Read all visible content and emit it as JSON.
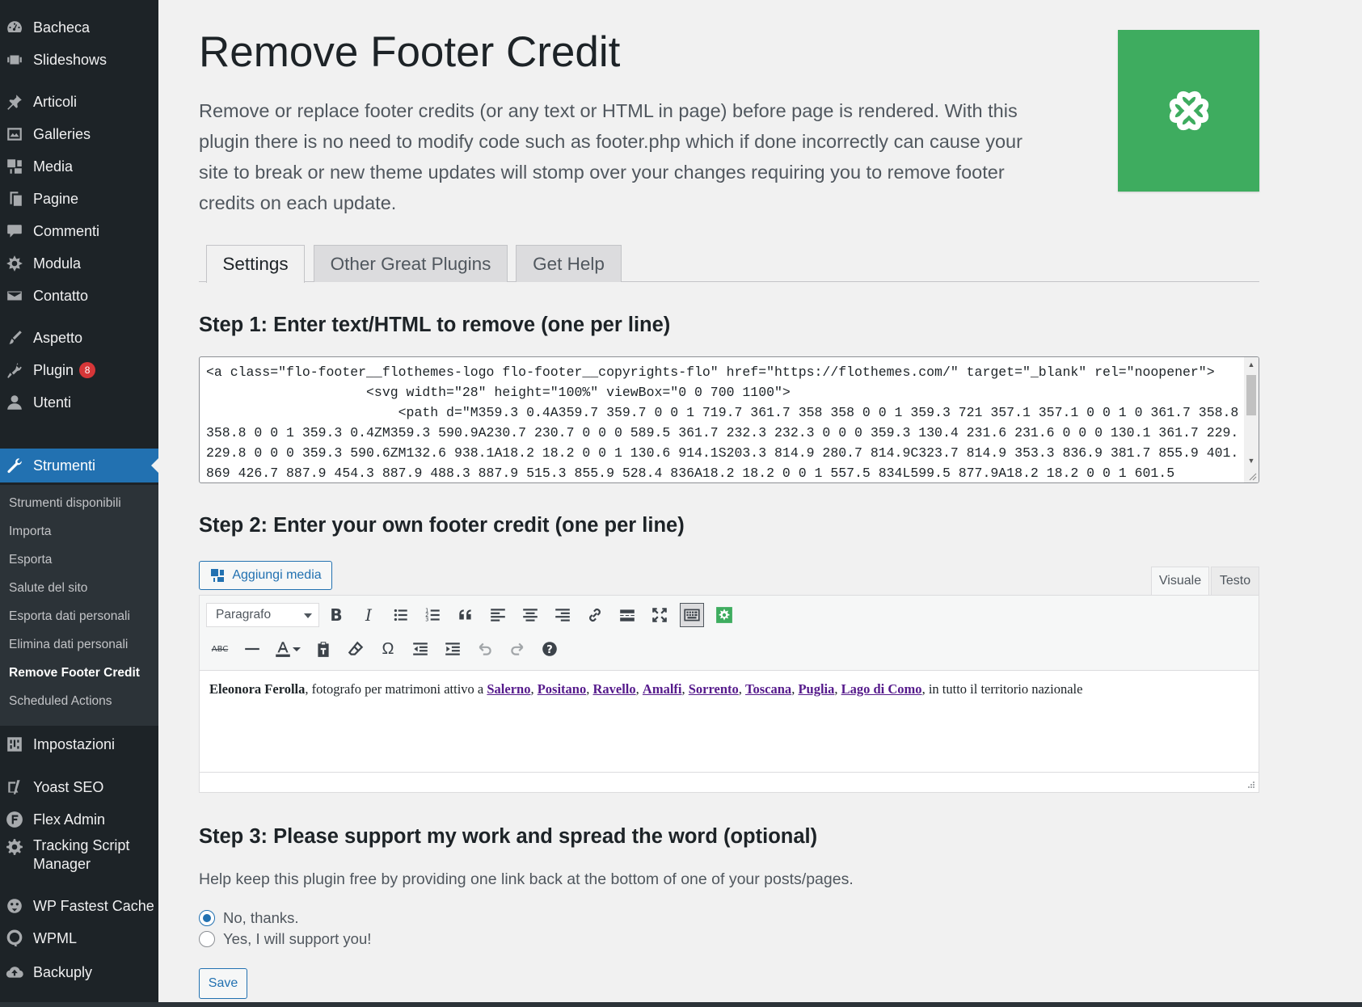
{
  "sidebar": {
    "items": [
      {
        "label": "Bacheca",
        "icon": "dashboard-icon"
      },
      {
        "label": "Slideshows",
        "icon": "slideshow-icon"
      },
      {
        "label": "Articoli",
        "icon": "pin-icon"
      },
      {
        "label": "Galleries",
        "icon": "gallery-icon"
      },
      {
        "label": "Media",
        "icon": "media-icon"
      },
      {
        "label": "Pagine",
        "icon": "page-icon"
      },
      {
        "label": "Commenti",
        "icon": "comment-icon"
      },
      {
        "label": "Modula",
        "icon": "modula-icon"
      },
      {
        "label": "Contatto",
        "icon": "mail-icon"
      },
      {
        "label": "Aspetto",
        "icon": "brush-icon"
      },
      {
        "label": "Plugin",
        "icon": "plugin-icon",
        "badge": "8"
      },
      {
        "label": "Utenti",
        "icon": "user-icon"
      },
      {
        "label": "Strumenti",
        "icon": "wrench-icon",
        "active": true
      },
      {
        "label": "Impostazioni",
        "icon": "settings-icon"
      },
      {
        "label": "Yoast SEO",
        "icon": "yoast-icon"
      },
      {
        "label": "Flex Admin",
        "icon": "flex-admin-icon"
      },
      {
        "label": "Tracking Script Manager",
        "icon": "gear-icon"
      },
      {
        "label": "WP Fastest Cache",
        "icon": "cheetah-icon"
      },
      {
        "label": "WPML",
        "icon": "wpml-icon"
      },
      {
        "label": "Backuply",
        "icon": "cloud-upload-icon"
      }
    ],
    "submenu": [
      "Strumenti disponibili",
      "Importa",
      "Esporta",
      "Salute del sito",
      "Esporta dati personali",
      "Elimina dati personali",
      "Remove Footer Credit",
      "Scheduled Actions"
    ]
  },
  "page": {
    "title": "Remove Footer Credit",
    "description": "Remove or replace footer credits (or any text or HTML in page) before page is rendered. With this plugin there is no need to modify code such as footer.php which if done incorrectly can cause your site to break or new theme updates will stomp over your changes requiring you to remove footer credits on each update.",
    "banner_color": "#3eac5f",
    "tabs": [
      "Settings",
      "Other Great Plugins",
      "Get Help"
    ],
    "active_tab": "Settings"
  },
  "step1": {
    "title": "Step 1: Enter text/HTML to remove (one per line)",
    "lines": [
      "<a class=\"flo-footer__flothemes-logo flo-footer__copyrights-flo\" href=\"https://flothemes.com/\" target=\"_blank\" rel=\"noopener\">",
      "                    <svg width=\"28\" height=\"100%\" viewBox=\"0 0 700 1100\">",
      "                        <path d=\"M359.3 0.4A359.7 359.7 0 0 1 719.7 361.7 358 358 0 0 1 359.3 721 357.1 357.1 0 0 1 0 361.7 358.8",
      "358.8 0 0 1 359.3 0.4ZM359.3 590.9A230.7 230.7 0 0 0 589.5 361.7 232.3 232.3 0 0 0 359.3 130.4 231.6 231.6 0 0 0 130.1 361.7 229.8",
      "229.8 0 0 0 359.3 590.6ZM132.6 938.1A18.2 18.2 0 0 1 130.6 914.1S203.3 814.9 280.7 814.9C323.7 814.9 353.3 836.9 381.7 855.9 401.6",
      "869 426.7 887.9 454.3 887.9 488.3 887.9 515.3 855.9 528.4 836A18.2 18.2 0 0 1 557.5 834L599.5 877.9A18.2 18.2 0 0 1 601.5"
    ]
  },
  "step2": {
    "title": "Step 2: Enter your own footer credit (one per line)",
    "add_media_label": "Aggiungi media",
    "editor_tabs": [
      "Visuale",
      "Testo"
    ],
    "format_select": "Paragrafo",
    "content": {
      "name": "Eleonora Ferolla",
      "intro": ", fotografo per matrimoni attivo a ",
      "links": [
        "Salerno",
        "Positano",
        "Ravello",
        "Amalfi",
        "Sorrento",
        "Toscana",
        "Puglia",
        "Lago di Como"
      ],
      "outro": ", in tutto il territorio nazionale"
    }
  },
  "step3": {
    "title": "Step 3: Please support my work and spread the word (optional)",
    "help": "Help keep this plugin free by providing one link back at the bottom of one of your posts/pages.",
    "options": [
      {
        "label": "No, thanks.",
        "checked": true
      },
      {
        "label": "Yes, I will support you!",
        "checked": false
      }
    ],
    "save_label": "Save"
  },
  "colors": {
    "sidebar_bg": "#1d2327",
    "active_menu": "#2271b1",
    "badge": "#d63638",
    "link": "#551a8b"
  }
}
